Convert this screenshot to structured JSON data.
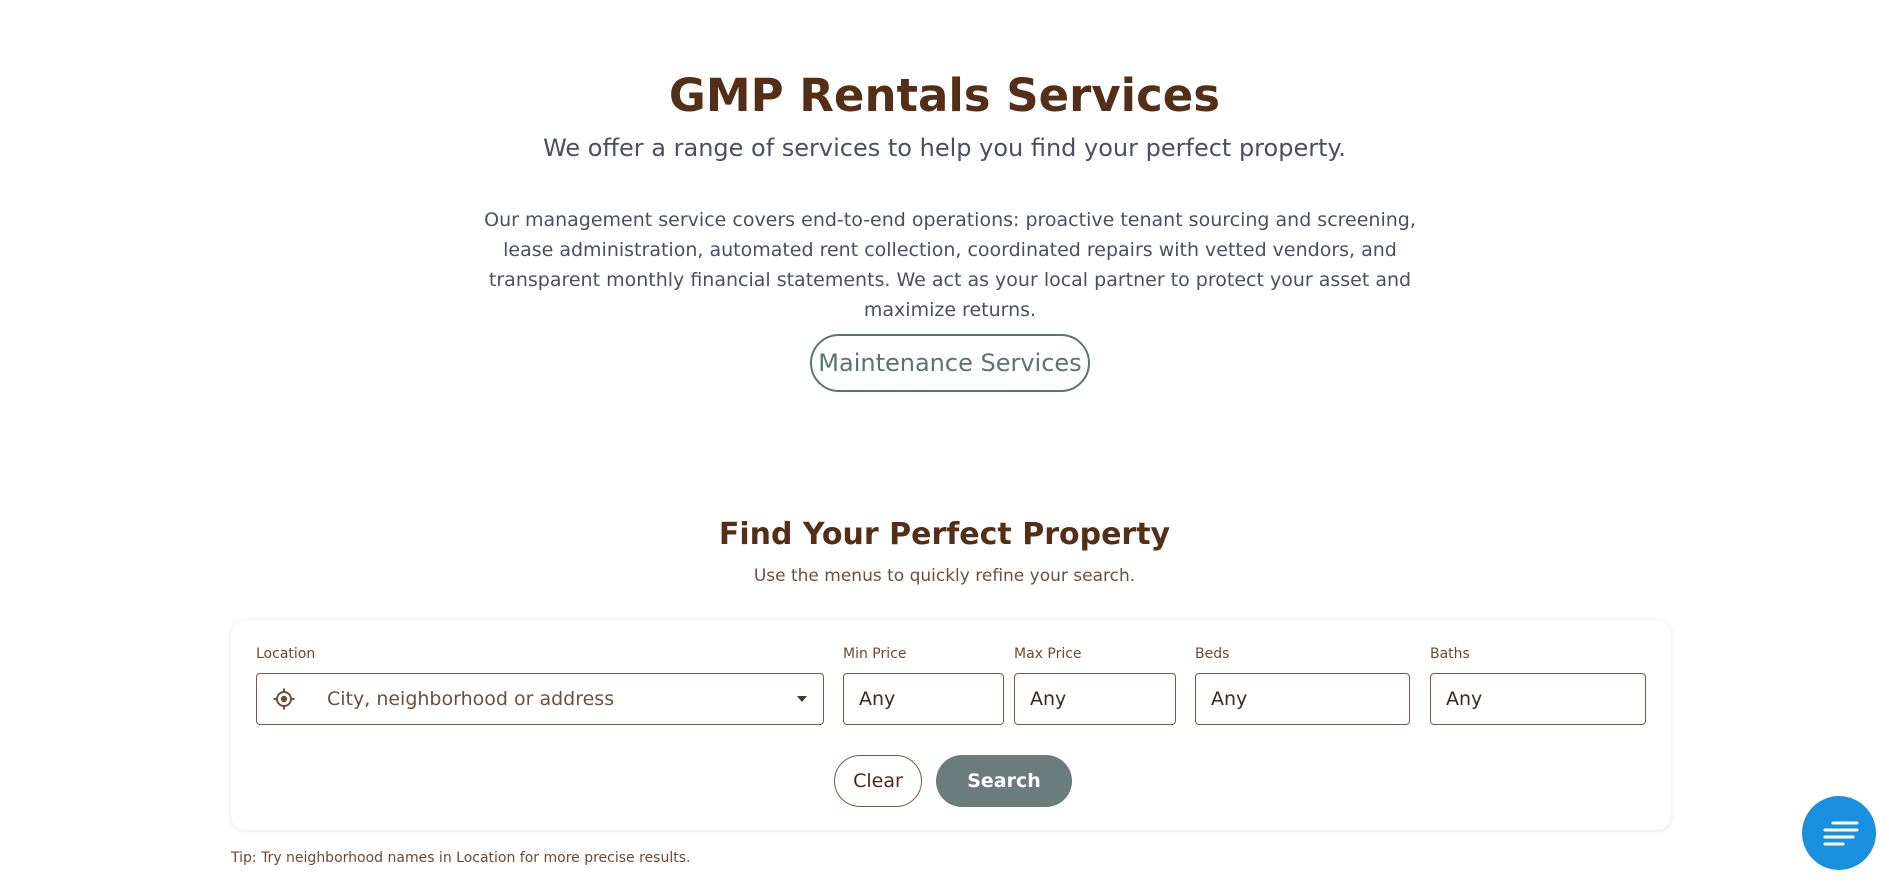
{
  "hero": {
    "title": "GMP Rentals Services",
    "subtitle": "We offer a range of services to help you find your perfect property.",
    "body": "Our management service covers end-to-end operations: proactive tenant sourcing and screening, lease administration, automated rent collection, coordinated repairs with vetted vendors, and transparent monthly financial statements. We act as your local partner to protect your asset and maximize returns.",
    "maintenance_button": "Maintenance Services"
  },
  "search": {
    "title": "Find Your Perfect Property",
    "subtitle": "Use the menus to quickly refine your search.",
    "location": {
      "label": "Location",
      "placeholder": "City, neighborhood or address",
      "icon": "locate-icon"
    },
    "min_price": {
      "label": "Min Price",
      "placeholder": "Any"
    },
    "max_price": {
      "label": "Max Price",
      "placeholder": "Any"
    },
    "beds": {
      "label": "Beds",
      "placeholder": "Any"
    },
    "baths": {
      "label": "Baths",
      "placeholder": "Any"
    },
    "clear_label": "Clear",
    "search_label": "Search",
    "tip": "Tip: Try neighborhood names in Location for more precise results."
  },
  "chat": {
    "icon": "menu-lines-icon"
  },
  "colors": {
    "heading": "#542f18",
    "accent": "#6a7d7c",
    "fab": "#1a8fe0"
  }
}
